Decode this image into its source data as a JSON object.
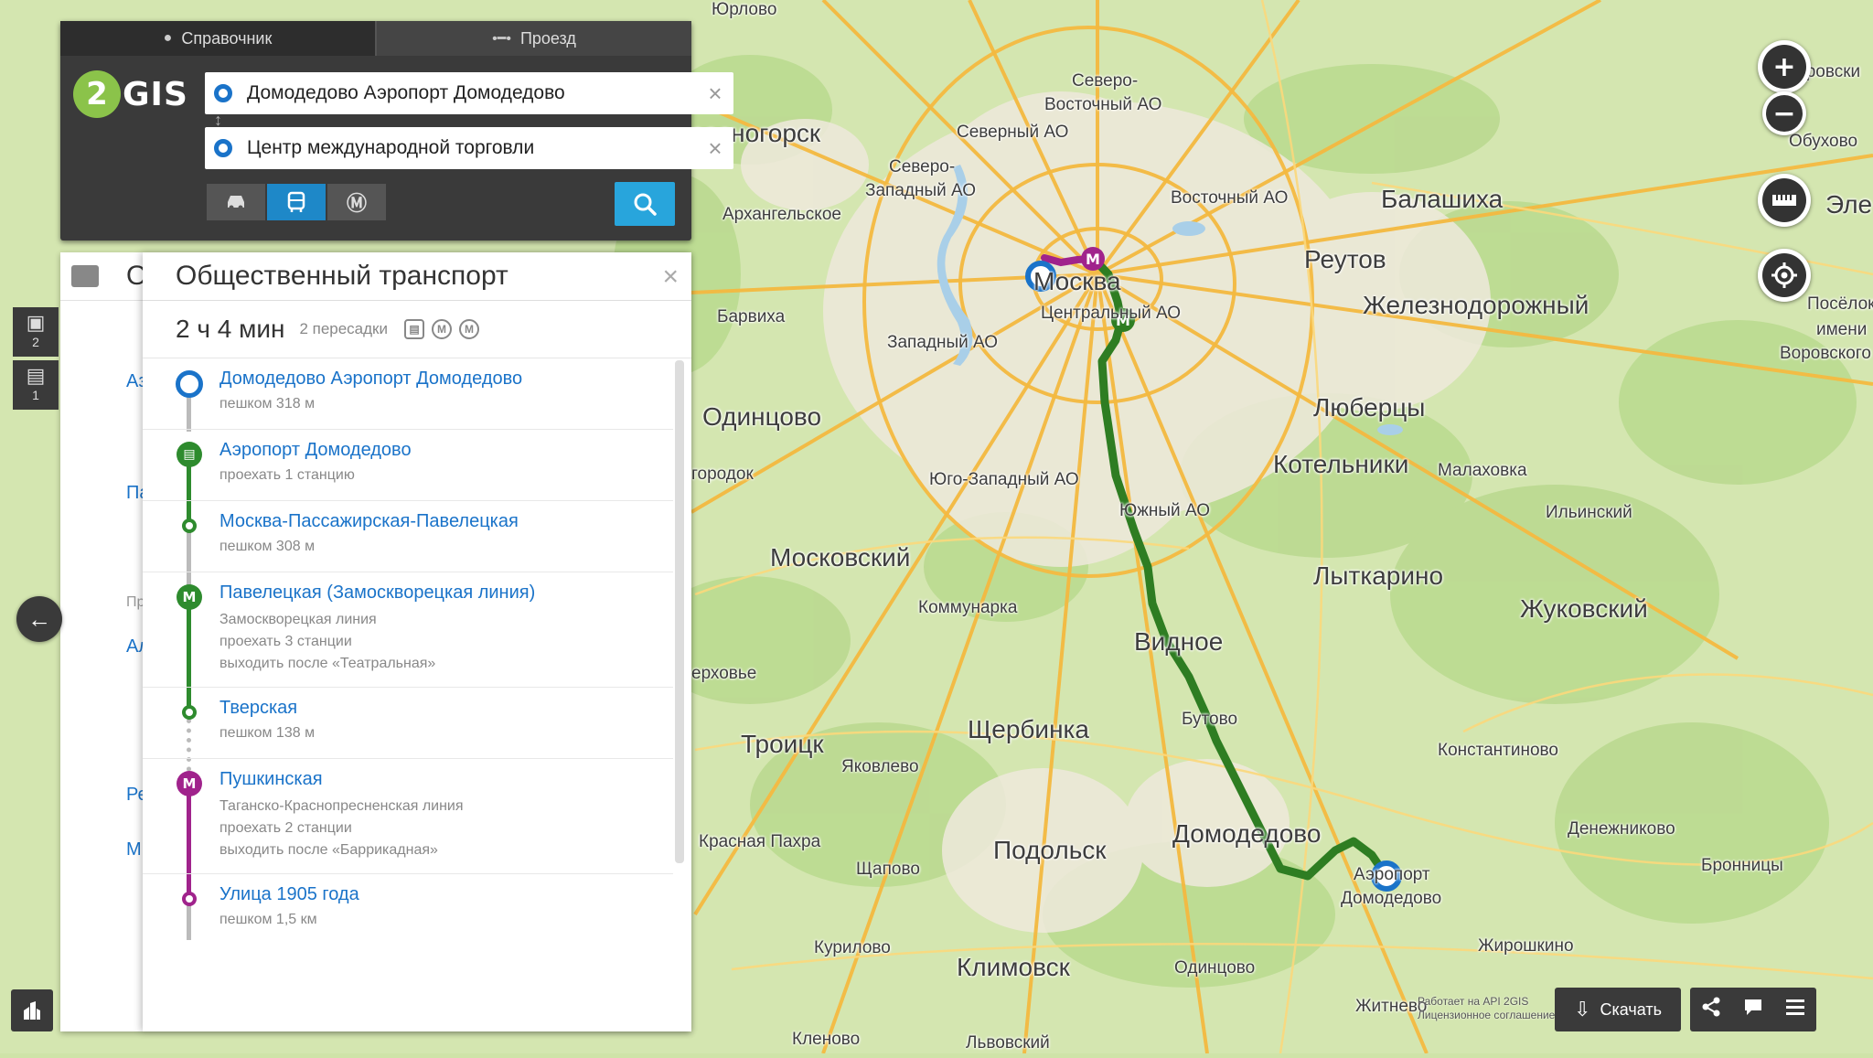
{
  "app": {
    "logo_text": "2GIS",
    "accent_color": "#1a73c9",
    "metro_green": "#2e8b2e",
    "metro_purple": "#a0238c"
  },
  "search": {
    "tabs": [
      {
        "label": "Справочник",
        "icon": "pin-icon",
        "active": false
      },
      {
        "label": "Проезд",
        "icon": "route-icon",
        "active": true
      }
    ],
    "from": "Домодедово Аэропорт Домодедово",
    "to": "Центр международной торговли",
    "modes": [
      {
        "icon": "car-icon",
        "active": false
      },
      {
        "icon": "bus-icon",
        "active": true
      },
      {
        "icon": "metro-icon",
        "active": false
      }
    ]
  },
  "left_panel": {
    "title": "Орга",
    "side_counts": [
      "2",
      "1"
    ],
    "list_items": [
      "Аз",
      "Па",
      "Пр",
      "Ал",
      "Ре",
      "М"
    ]
  },
  "route": {
    "title": "Общественный транспорт",
    "duration": "2 ч 4 мин",
    "transfers": "2 пересадки",
    "steps": [
      {
        "name": "Домодедово Аэропорт Домодедово",
        "details": [
          "пешком 318 м"
        ],
        "node": "start"
      },
      {
        "name": "Аэропорт Домодедово",
        "details": [
          "проехать 1 станцию"
        ],
        "node": "train"
      },
      {
        "name": "Москва-Пассажирская-Павелецкая",
        "details": [
          "пешком 308 м"
        ],
        "node": "dot-green"
      },
      {
        "name": "Павелецкая (Замоскворецкая линия)",
        "details": [
          "Замоскворецкая линия",
          "проехать 3 станции",
          "выходить после «Театральная»"
        ],
        "node": "metro-green"
      },
      {
        "name": "Тверская",
        "details": [
          "пешком 138 м"
        ],
        "node": "dot-green"
      },
      {
        "name": "Пушкинская",
        "details": [
          "Таганско-Краснопресненская линия",
          "проехать 2 станции",
          "выходить после «Баррикадная»"
        ],
        "node": "metro-purple"
      },
      {
        "name": "Улица 1905 года",
        "details": [
          "пешком 1,5 км"
        ],
        "node": "dot-purple"
      }
    ]
  },
  "map": {
    "labels": [
      {
        "text": "Юрлово",
        "size": "sm"
      },
      {
        "text": "Северо-",
        "size": "sm"
      },
      {
        "text": "Восточный АО",
        "size": "sm"
      },
      {
        "text": "Северный АО",
        "size": "sm"
      },
      {
        "text": "расногорск",
        "size": "big"
      },
      {
        "text": "Северо-",
        "size": "sm"
      },
      {
        "text": "Западный АО",
        "size": "sm"
      },
      {
        "text": "Восточный АО",
        "size": "sm"
      },
      {
        "text": "Балашиха",
        "size": "big"
      },
      {
        "text": "Архангельское",
        "size": "sm"
      },
      {
        "text": "Реутов",
        "size": "big"
      },
      {
        "text": "Москва",
        "size": "big"
      },
      {
        "text": "Центральный АО",
        "size": "sm"
      },
      {
        "text": "Железнодорожный",
        "size": "big"
      },
      {
        "text": "Барвиха",
        "size": "sm"
      },
      {
        "text": "Западный АО",
        "size": "sm"
      },
      {
        "text": "Одинцово",
        "size": "big"
      },
      {
        "text": "Люберцы",
        "size": "big"
      },
      {
        "text": "Котельники",
        "size": "big"
      },
      {
        "text": "Малаховка",
        "size": "sm"
      },
      {
        "text": "городок",
        "size": "sm"
      },
      {
        "text": "Юго-Западный АО",
        "size": "sm"
      },
      {
        "text": "Южный АО",
        "size": "sm"
      },
      {
        "text": "Ильинский",
        "size": "sm"
      },
      {
        "text": "Московский",
        "size": "big"
      },
      {
        "text": "Лыткарино",
        "size": "big"
      },
      {
        "text": "Коммунарка",
        "size": "sm"
      },
      {
        "text": "Жуковский",
        "size": "big"
      },
      {
        "text": "Видное",
        "size": "big"
      },
      {
        "text": "ерховье",
        "size": "sm"
      },
      {
        "text": "Щербинка",
        "size": "big"
      },
      {
        "text": "Бутово",
        "size": "sm"
      },
      {
        "text": "Троицк",
        "size": "big"
      },
      {
        "text": "Константиново",
        "size": "sm"
      },
      {
        "text": "Яковлево",
        "size": "sm"
      },
      {
        "text": "Денежниково",
        "size": "sm"
      },
      {
        "text": "Домодедово",
        "size": "big"
      },
      {
        "text": "Красная Пахра",
        "size": "sm"
      },
      {
        "text": "Подольск",
        "size": "big"
      },
      {
        "text": "Аэропорт",
        "size": "sm"
      },
      {
        "text": "Домодедово",
        "size": "sm"
      },
      {
        "text": "Щапово",
        "size": "sm"
      },
      {
        "text": "Бронницы",
        "size": "sm"
      },
      {
        "text": "Курилово",
        "size": "sm"
      },
      {
        "text": "Жирошкино",
        "size": "sm"
      },
      {
        "text": "Климовск",
        "size": "big"
      },
      {
        "text": "Одинцово",
        "size": "sm"
      },
      {
        "text": "Житнево",
        "size": "sm"
      },
      {
        "text": "Кленово",
        "size": "sm"
      },
      {
        "text": "Львовский",
        "size": "sm"
      },
      {
        "text": "тровски",
        "size": "sm"
      },
      {
        "text": "Обухово",
        "size": "sm"
      },
      {
        "text": "Эле",
        "size": "big"
      },
      {
        "text": "Посёлок",
        "size": "sm"
      },
      {
        "text": "имени",
        "size": "sm"
      },
      {
        "text": "Воровского",
        "size": "sm"
      }
    ],
    "controls": [
      "zoom-in-icon",
      "zoom-out-icon",
      "ruler-icon",
      "locate-icon"
    ],
    "api_note": "Работает на API 2GIS",
    "license_note": "Лицензионное соглашение",
    "download_label": "Скачать"
  }
}
